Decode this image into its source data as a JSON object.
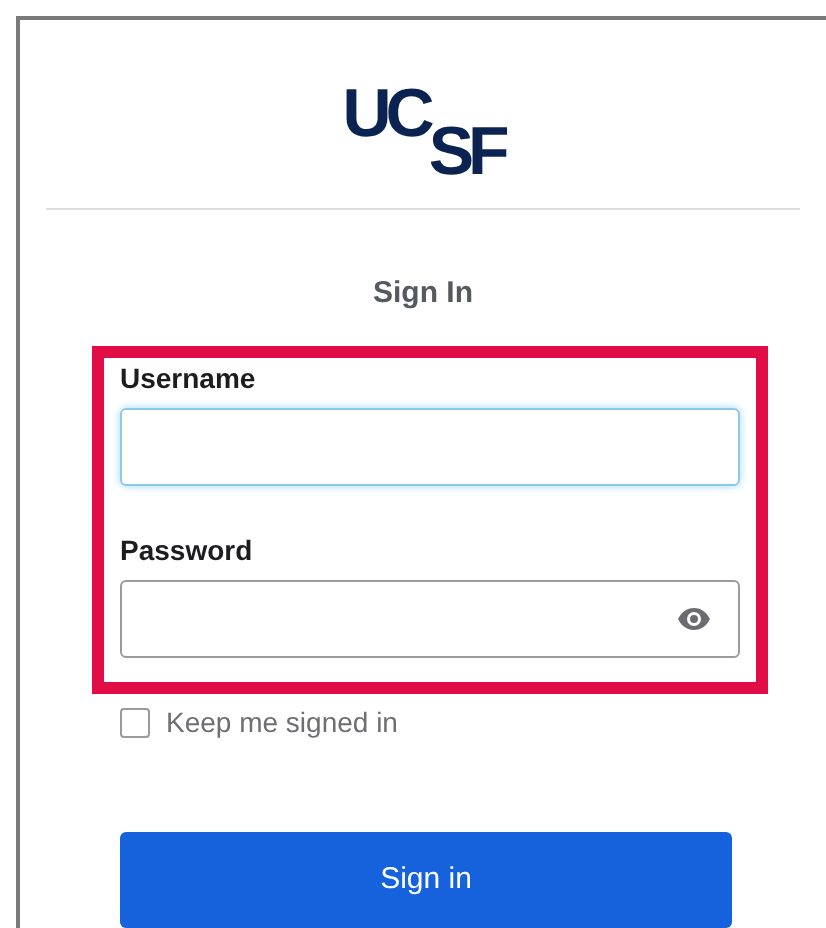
{
  "logo": "UC$_{SF}$",
  "heading": "Sign In",
  "fields": [
    {
      "label": "Username",
      "kind": "text",
      "focused": true
    },
    {
      "label": "Password",
      "kind": "password",
      "focused": false
    }
  ],
  "remember": {
    "label": "Keep me signed in",
    "checked": false
  },
  "submit": "Sign in"
}
